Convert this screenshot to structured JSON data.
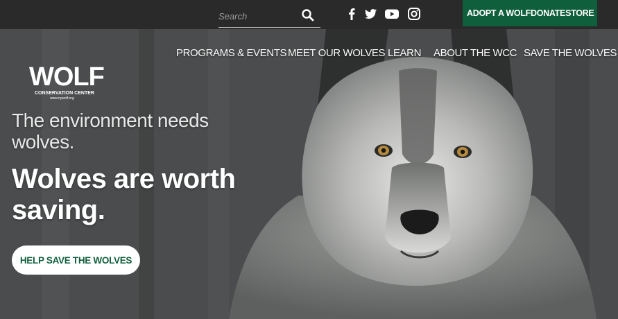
{
  "search": {
    "placeholder": "Search"
  },
  "social": [
    "facebook-icon",
    "twitter-icon",
    "youtube-icon",
    "instagram-icon"
  ],
  "utility_nav": {
    "adopt": "ADOPT A WOLF",
    "donate": "DONATE",
    "store": "STORE",
    "bg": "#0f5f3d"
  },
  "logo": {
    "word": "WOLF",
    "subtitle": "CONSERVATION CENTER",
    "url": "www.nywolf.org"
  },
  "main_nav": {
    "programs": "PROGRAMS & EVENTS",
    "wolves": "MEET OUR WOLVES",
    "learn": "LEARN",
    "about": "ABOUT THE WCC",
    "save": "SAVE THE WOLVES"
  },
  "hero": {
    "tagline": "The environment needs wolves.",
    "headline": "Wolves are worth saving.",
    "cta": "HELP SAVE THE WOLVES"
  },
  "colors": {
    "accent": "#0f5f3d",
    "topbar": "#2a2a2a"
  }
}
